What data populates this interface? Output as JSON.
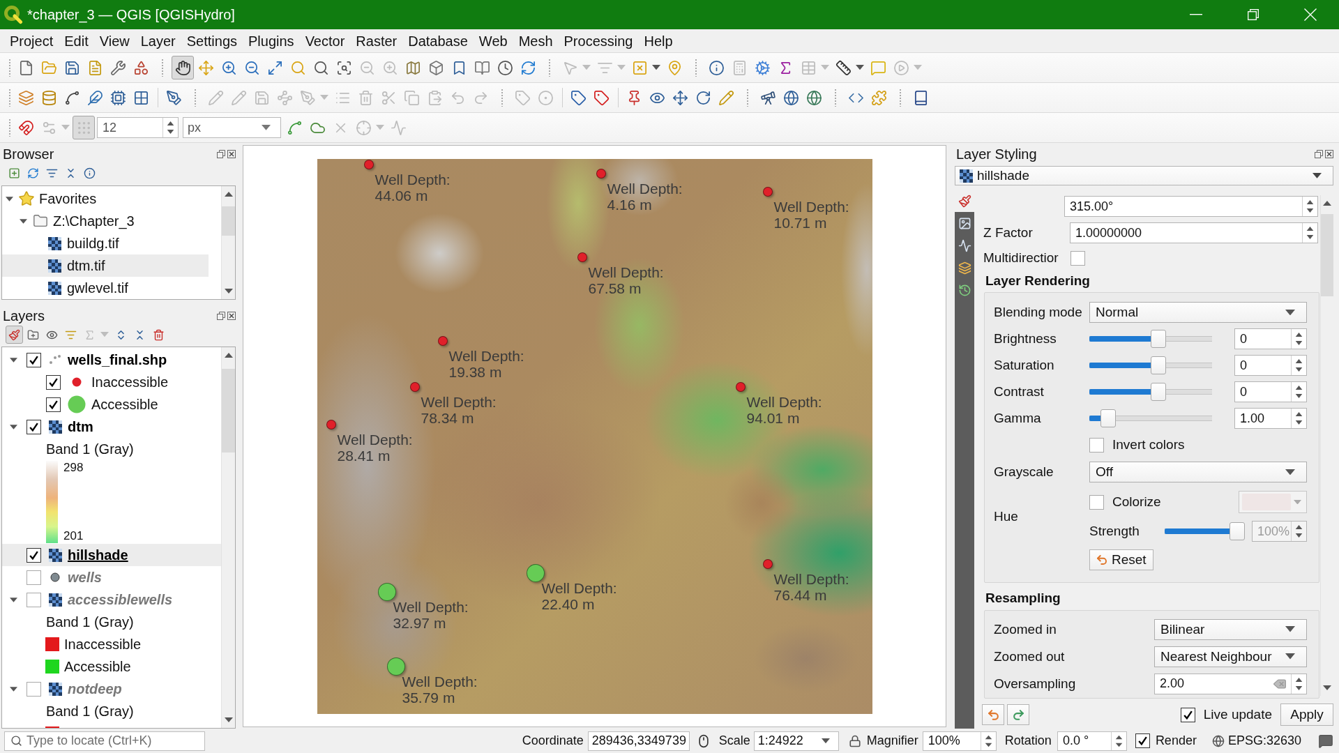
{
  "window": {
    "title": "*chapter_3 — QGIS [QGISHydro]"
  },
  "menu": [
    "Project",
    "Edit",
    "View",
    "Layer",
    "Settings",
    "Plugins",
    "Vector",
    "Raster",
    "Database",
    "Web",
    "Mesh",
    "Processing",
    "Help"
  ],
  "toolbars": [
    {
      "items": [
        {
          "disabled": false,
          "selected": false,
          "menu": false
        },
        {
          "disabled": false,
          "selected": false,
          "menu": false
        },
        {
          "disabled": false,
          "selected": false,
          "menu": false
        },
        {
          "disabled": false,
          "selected": false,
          "menu": false
        },
        {
          "disabled": false,
          "selected": false,
          "menu": false
        },
        {
          "disabled": false,
          "selected": false,
          "menu": false
        },
        {
          "disabled": false,
          "selected": true,
          "menu": false
        },
        {
          "disabled": false,
          "selected": false,
          "menu": false
        },
        {
          "disabled": false,
          "selected": false,
          "menu": false
        },
        {
          "disabled": false,
          "selected": false,
          "menu": false
        },
        {
          "disabled": false,
          "selected": false,
          "menu": false
        },
        {
          "disabled": false,
          "selected": false,
          "menu": false
        },
        {
          "disabled": false,
          "selected": false,
          "menu": false
        },
        {
          "disabled": false,
          "selected": false,
          "menu": false
        },
        {
          "disabled": true,
          "selected": false,
          "menu": false
        },
        {
          "disabled": true,
          "selected": false,
          "menu": false
        },
        {
          "disabled": false,
          "selected": false,
          "menu": false
        },
        {
          "disabled": false,
          "selected": false,
          "menu": false
        },
        {
          "disabled": false,
          "selected": false,
          "menu": false
        },
        {
          "disabled": false,
          "selected": false,
          "menu": false
        },
        {
          "disabled": false,
          "selected": false,
          "menu": false
        },
        {
          "disabled": false,
          "selected": false,
          "menu": false
        },
        {
          "disabled": true,
          "selected": false,
          "menu": true
        },
        {
          "disabled": true,
          "selected": false,
          "menu": true
        },
        {
          "disabled": false,
          "selected": false,
          "menu": true
        },
        {
          "disabled": false,
          "selected": false,
          "menu": false
        },
        {
          "disabled": false,
          "selected": false,
          "menu": false
        },
        {
          "disabled": true,
          "selected": false,
          "menu": false
        },
        {
          "disabled": false,
          "selected": false,
          "menu": false
        },
        {
          "disabled": false,
          "selected": false,
          "menu": false
        },
        {
          "disabled": true,
          "selected": false,
          "menu": true
        },
        {
          "disabled": false,
          "selected": false,
          "menu": true
        },
        {
          "disabled": false,
          "selected": false,
          "menu": false
        },
        {
          "disabled": true,
          "selected": false,
          "menu": true
        }
      ]
    },
    {
      "items": [
        {
          "disabled": false,
          "selected": false,
          "menu": false
        },
        {
          "disabled": false,
          "selected": false,
          "menu": false
        },
        {
          "disabled": false,
          "selected": false,
          "menu": false
        },
        {
          "disabled": false,
          "selected": false,
          "menu": false
        },
        {
          "disabled": false,
          "selected": false,
          "menu": false
        },
        {
          "disabled": false,
          "selected": false,
          "menu": false
        },
        {
          "disabled": false,
          "selected": false,
          "menu": false
        },
        {
          "disabled": true,
          "selected": false,
          "menu": false
        },
        {
          "disabled": true,
          "selected": false,
          "menu": false
        },
        {
          "disabled": true,
          "selected": false,
          "menu": false
        },
        {
          "disabled": true,
          "selected": false,
          "menu": false
        },
        {
          "disabled": true,
          "selected": false,
          "menu": true
        },
        {
          "disabled": true,
          "selected": false,
          "menu": false
        },
        {
          "disabled": true,
          "selected": false,
          "menu": false
        },
        {
          "disabled": true,
          "selected": false,
          "menu": false
        },
        {
          "disabled": true,
          "selected": false,
          "menu": false
        },
        {
          "disabled": true,
          "selected": false,
          "menu": false
        },
        {
          "disabled": true,
          "selected": false,
          "menu": false
        },
        {
          "disabled": true,
          "selected": false,
          "menu": false
        },
        {
          "disabled": true,
          "selected": false,
          "menu": false
        },
        {
          "disabled": true,
          "selected": false,
          "menu": false
        },
        {
          "disabled": false,
          "selected": false,
          "menu": false
        },
        {
          "disabled": false,
          "selected": false,
          "menu": false
        },
        {
          "disabled": false,
          "selected": false,
          "menu": false
        },
        {
          "disabled": false,
          "selected": false,
          "menu": false
        },
        {
          "disabled": false,
          "selected": false,
          "menu": false
        },
        {
          "disabled": false,
          "selected": false,
          "menu": false
        },
        {
          "disabled": false,
          "selected": false,
          "menu": false
        },
        {
          "disabled": false,
          "selected": false,
          "menu": false
        },
        {
          "disabled": false,
          "selected": false,
          "menu": false
        },
        {
          "disabled": false,
          "selected": false,
          "menu": false
        },
        {
          "disabled": false,
          "selected": false,
          "menu": false
        },
        {
          "disabled": false,
          "selected": false,
          "menu": false
        },
        {
          "disabled": false,
          "selected": false,
          "menu": false
        }
      ]
    }
  ],
  "snapping_toolbar": {
    "before": [
      {
        "disabled": false,
        "selected": false,
        "menu": false
      },
      {
        "disabled": true,
        "selected": false,
        "menu": true
      },
      {
        "disabled": true,
        "selected": true,
        "menu": false
      }
    ],
    "tolerance": "12",
    "units": "px",
    "after": [
      {
        "disabled": false,
        "selected": false,
        "menu": false
      },
      {
        "disabled": false,
        "selected": false,
        "menu": false
      },
      {
        "disabled": true,
        "selected": false,
        "menu": false
      },
      {
        "disabled": true,
        "selected": false,
        "menu": true
      },
      {
        "disabled": true,
        "selected": false,
        "menu": false
      }
    ]
  },
  "browser": {
    "title": "Browser",
    "toolbar": [
      {
        "disabled": false,
        "selected": false,
        "menu": false
      },
      {
        "disabled": false,
        "selected": false,
        "menu": false
      },
      {
        "disabled": false,
        "selected": false,
        "menu": false
      },
      {
        "disabled": false,
        "selected": false,
        "menu": false
      },
      {
        "disabled": false,
        "selected": false,
        "menu": false
      }
    ],
    "tree": [
      {
        "kind": "favorites",
        "label": "Favorites",
        "expanded": true,
        "selected": false,
        "children": [
          {
            "kind": "folder",
            "label": "Z:\\Chapter_3",
            "expanded": true,
            "selected": false,
            "children": [
              {
                "kind": "raster",
                "label": "buildg.tif",
                "selected": false
              },
              {
                "kind": "raster",
                "label": "dtm.tif",
                "selected": true
              },
              {
                "kind": "raster",
                "label": "gwlevel.tif",
                "selected": false
              }
            ]
          }
        ]
      }
    ]
  },
  "layers": {
    "title": "Layers",
    "toolbar": [
      {
        "disabled": false,
        "selected": true,
        "menu": false
      },
      {
        "disabled": false,
        "selected": false,
        "menu": false
      },
      {
        "disabled": false,
        "selected": false,
        "menu": false
      },
      {
        "disabled": false,
        "selected": false,
        "menu": false
      },
      {
        "disabled": true,
        "selected": false,
        "menu": true
      },
      {
        "disabled": false,
        "selected": false,
        "menu": false
      },
      {
        "disabled": false,
        "selected": false,
        "menu": false
      },
      {
        "disabled": false,
        "selected": false,
        "menu": false
      }
    ],
    "tree": [
      {
        "kind": "categorized",
        "label": "wells_final.shp",
        "checked": true,
        "selected": false,
        "expanded": true,
        "children": [
          {
            "kind": "small-point",
            "label": "Inaccessible",
            "checked": true,
            "color": "#e0202a"
          },
          {
            "kind": "large-point",
            "label": "Accessible",
            "checked": true,
            "color": "#66cc55"
          }
        ]
      },
      {
        "kind": "raster",
        "label": "dtm",
        "checked": true,
        "selected": false,
        "expanded": true,
        "children": [
          {
            "kind": "text",
            "label": "Band 1 (Gray)"
          },
          {
            "kind": "ramp",
            "max": "298",
            "min": "201"
          }
        ]
      },
      {
        "kind": "raster",
        "label": "hillshade",
        "checked": true,
        "selected": true
      },
      {
        "kind": "single-symbol",
        "label": "wells",
        "checked": false,
        "selected": false
      },
      {
        "kind": "raster",
        "label": "accessiblewells",
        "checked": false,
        "selected": false,
        "expanded": true,
        "children": [
          {
            "kind": "text",
            "label": "Band 1 (Gray)"
          },
          {
            "kind": "swatch",
            "label": "Inaccessible",
            "color": "#e3191c"
          },
          {
            "kind": "swatch",
            "label": "Accessible",
            "color": "#1fd61f"
          }
        ]
      },
      {
        "kind": "raster",
        "label": "notdeep",
        "checked": false,
        "selected": false,
        "expanded": true,
        "children": [
          {
            "kind": "text",
            "label": "Band 1 (Gray)"
          },
          {
            "kind": "swatch",
            "color": "#e3191c"
          }
        ]
      }
    ]
  },
  "map": {
    "wells": [
      {
        "kind": "inaccessible",
        "color": "#e0202a",
        "title": "Well Depth:",
        "depth": "44.06 m"
      },
      {
        "kind": "inaccessible",
        "color": "#e0202a",
        "title": "Well Depth:",
        "depth": "4.16 m"
      },
      {
        "kind": "inaccessible",
        "color": "#e0202a",
        "title": "Well Depth:",
        "depth": "10.71 m"
      },
      {
        "kind": "inaccessible",
        "color": "#e0202a",
        "title": "Well Depth:",
        "depth": "67.58 m"
      },
      {
        "kind": "inaccessible",
        "color": "#e0202a",
        "title": "Well Depth:",
        "depth": "19.38 m"
      },
      {
        "kind": "inaccessible",
        "color": "#e0202a",
        "title": "Well Depth:",
        "depth": "78.34 m"
      },
      {
        "kind": "inaccessible",
        "color": "#e0202a",
        "title": "Well Depth:",
        "depth": "94.01 m"
      },
      {
        "kind": "inaccessible",
        "color": "#e0202a",
        "title": "Well Depth:",
        "depth": "28.41 m"
      },
      {
        "kind": "inaccessible",
        "color": "#e0202a",
        "title": "Well Depth:",
        "depth": "76.44 m"
      },
      {
        "kind": "accessible",
        "color": "#66cc55",
        "title": "Well Depth:",
        "depth": "22.40 m"
      },
      {
        "kind": "accessible",
        "color": "#66cc55",
        "title": "Well Depth:",
        "depth": "32.97 m"
      },
      {
        "kind": "accessible",
        "color": "#66cc55",
        "title": "Well Depth:",
        "depth": "35.79 m"
      }
    ]
  },
  "styling": {
    "title": "Layer Styling",
    "layer": "hillshade",
    "tabs": [
      {
        "selected": true
      },
      {
        "selected": false
      },
      {
        "selected": false
      },
      {
        "selected": false
      },
      {
        "selected": false
      }
    ],
    "unlabeled_spinbox": "315.00°",
    "z_factor": {
      "label": "Z Factor",
      "value": "1.00000000"
    },
    "multidirectional": {
      "label": "Multidirectior",
      "checked": false
    },
    "rendering": {
      "title": "Layer Rendering",
      "blending_mode": {
        "label": "Blending mode",
        "value": "Normal"
      },
      "sliders": [
        {
          "label": "Brightness",
          "level": 0.5,
          "value": "0"
        },
        {
          "label": "Saturation",
          "level": 0.5,
          "value": "0"
        },
        {
          "label": "Contrast",
          "level": 0.5,
          "value": "0"
        },
        {
          "label": "Gamma",
          "level": 0.09,
          "value": "1.00"
        }
      ],
      "invert_colors": {
        "label": "Invert colors",
        "checked": false
      },
      "grayscale": {
        "label": "Grayscale",
        "value": "Off"
      },
      "hue": {
        "label": "Hue",
        "colorize": {
          "label": "Colorize",
          "checked": false
        },
        "strength": {
          "label": "Strength",
          "level": 1,
          "value": "100%",
          "disabled": true
        }
      },
      "reset": "Reset"
    },
    "resampling": {
      "title": "Resampling",
      "zoomed_in": {
        "label": "Zoomed in",
        "value": "Bilinear"
      },
      "zoomed_out": {
        "label": "Zoomed out",
        "value": "Nearest Neighbour"
      },
      "oversampling": {
        "label": "Oversampling",
        "value": "2.00"
      }
    },
    "live_update": {
      "label": "Live update",
      "checked": true
    },
    "apply": "Apply"
  },
  "status_bar": {
    "locator": {
      "placeholder": "Type to locate (Ctrl+K)"
    },
    "coordinate": {
      "label": "Coordinate",
      "value": "289436,3349739"
    },
    "scale": {
      "label": "Scale",
      "value": "1:24922"
    },
    "magnifier": {
      "label": "Magnifier",
      "value": "100%"
    },
    "rotation": {
      "label": "Rotation",
      "value": "0.0 °"
    },
    "render": {
      "label": "Render",
      "checked": true
    },
    "crs": "EPSG:32630"
  }
}
